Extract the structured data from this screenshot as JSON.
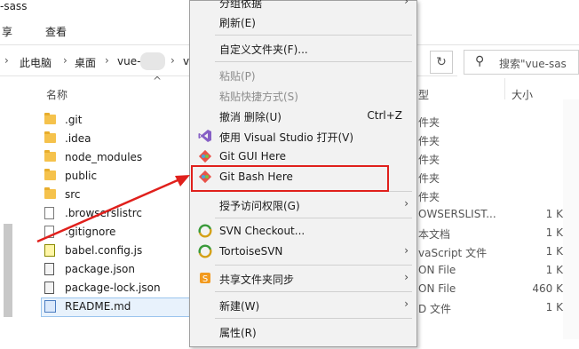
{
  "window": {
    "title": "-sass"
  },
  "ribbon": {
    "tabs": [
      "共享",
      "查看"
    ],
    "tab_share_visible": "享"
  },
  "address": {
    "crumbs": [
      "此电脑",
      "桌面",
      "vue-",
      "v"
    ],
    "search_placeholder": "搜索\"vue-sas"
  },
  "columns": {
    "name": "名称",
    "type": "型",
    "size": "大小"
  },
  "files": [
    {
      "name": ".git",
      "kind": "folder",
      "type": "件夹",
      "size": ""
    },
    {
      "name": ".idea",
      "kind": "folder",
      "type": "件夹",
      "size": ""
    },
    {
      "name": "node_modules",
      "kind": "folder",
      "type": "件夹",
      "size": ""
    },
    {
      "name": "public",
      "kind": "folder",
      "type": "件夹",
      "size": ""
    },
    {
      "name": "src",
      "kind": "folder",
      "type": "件夹",
      "size": ""
    },
    {
      "name": ".browserslistrc",
      "kind": "doc",
      "type": "OWSERSLIST...",
      "size": "1 K"
    },
    {
      "name": ".gitignore",
      "kind": "doc",
      "type": "本文档",
      "size": "1 K"
    },
    {
      "name": "babel.config.js",
      "kind": "js",
      "type": "vaScript 文件",
      "size": "1 K"
    },
    {
      "name": "package.json",
      "kind": "json",
      "type": "ON File",
      "size": "1 K"
    },
    {
      "name": "package-lock.json",
      "kind": "json",
      "type": "ON File",
      "size": "460 K"
    },
    {
      "name": "README.md",
      "kind": "md",
      "type": "D 文件",
      "size": "1 K"
    }
  ],
  "context_menu": {
    "top_partial": "分组依据",
    "refresh": "刷新(E)",
    "customize": "自定义文件夹(F)...",
    "paste": "粘贴(P)",
    "paste_shortcut": "粘贴快捷方式(S)",
    "undo_delete": "撤消 删除(U)",
    "undo_shortcut": "Ctrl+Z",
    "open_vs": "使用 Visual Studio 打开(V)",
    "git_gui": "Git GUI Here",
    "git_bash": "Git Bash Here",
    "grant_access": "授予访问权限(G)",
    "svn_checkout": "SVN Checkout...",
    "tortoise_svn": "TortoiseSVN",
    "sync_share": "共享文件夹同步",
    "new": "新建(W)",
    "properties": "属性(R)"
  },
  "colors": {
    "highlight": "#e0201c",
    "accent": "#4a7cc0"
  }
}
